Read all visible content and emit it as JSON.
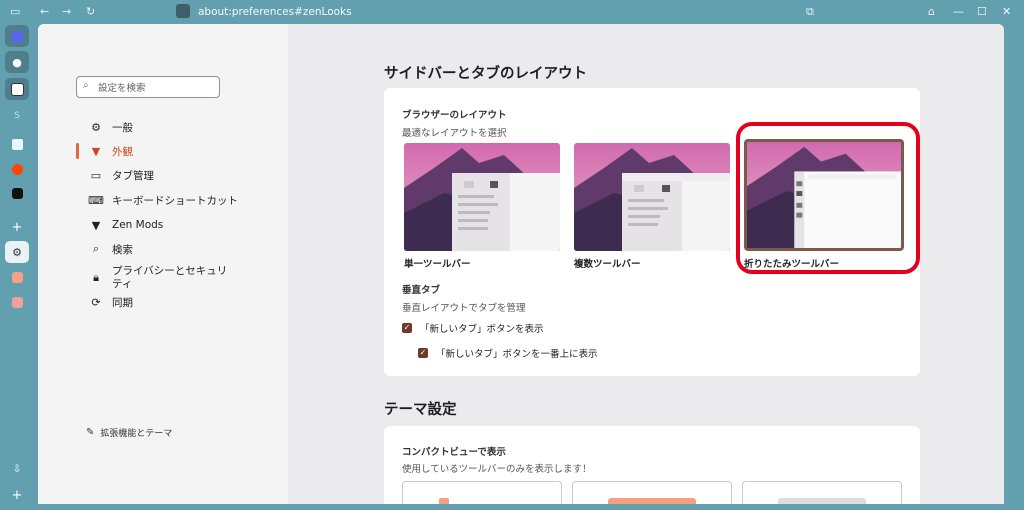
{
  "topbar": {
    "url": "about:preferences#zenLooks",
    "icons": [
      "sidebar-toggle-icon",
      "back-icon",
      "forward-icon",
      "reload-icon",
      "extension-puzzle-icon",
      "zen-shield-icon",
      "minimize-icon",
      "maximize-icon",
      "close-icon"
    ]
  },
  "vertical_sidebar": {
    "items": [
      "discord-icon",
      "github-icon",
      "notion-icon",
      "s-icon",
      "folder-icon",
      "reddit-icon",
      "x-icon",
      "add-icon",
      "settings-icon",
      "app1-icon",
      "app2-icon"
    ],
    "s_label": "S",
    "add_label": "+",
    "download_label": "⇩",
    "bottom_add_label": "+"
  },
  "nav": {
    "search_placeholder": "設定を検索",
    "items": [
      {
        "label": "一般",
        "icon": "gear-icon"
      },
      {
        "label": "外観",
        "icon": "paint-brush-icon"
      },
      {
        "label": "タブ管理",
        "icon": "window-icon"
      },
      {
        "label": "キーボードショートカット",
        "icon": "keyboard-icon"
      },
      {
        "label": "Zen Mods",
        "icon": "brush-icon"
      },
      {
        "label": "検索",
        "icon": "search-icon"
      },
      {
        "label": "プライバシーとセキュリ\nティ",
        "icon": "lock-icon"
      },
      {
        "label": "同期",
        "icon": "sync-icon"
      }
    ],
    "extensions_label": "拡張機能とテーマ"
  },
  "layout_section": {
    "title": "サイドバーとタブのレイアウト",
    "browser_layout_title": "ブラウザーのレイアウト",
    "browser_layout_desc": "最適なレイアウトを選択",
    "options": [
      {
        "label": "単一ツールバー"
      },
      {
        "label": "複数ツールバー"
      },
      {
        "label": "折りたたみツールバー",
        "selected": true
      }
    ],
    "vertical_tabs_title": "垂直タブ",
    "vertical_tabs_desc": "垂直レイアウトでタブを管理",
    "checkbox1": "「新しいタブ」ボタンを表示",
    "checkbox2": "「新しいタブ」ボタンを一番上に表示"
  },
  "theme_section": {
    "title": "テーマ設定",
    "compact_title": "コンパクトビューで表示",
    "compact_desc": "使用しているツールバーのみを表示します！"
  },
  "colors": {
    "page_bg": "#62a0b0",
    "accent": "#e36a3a",
    "highlight_red": "#e4001c",
    "checkbox": "#6b3b2b"
  }
}
